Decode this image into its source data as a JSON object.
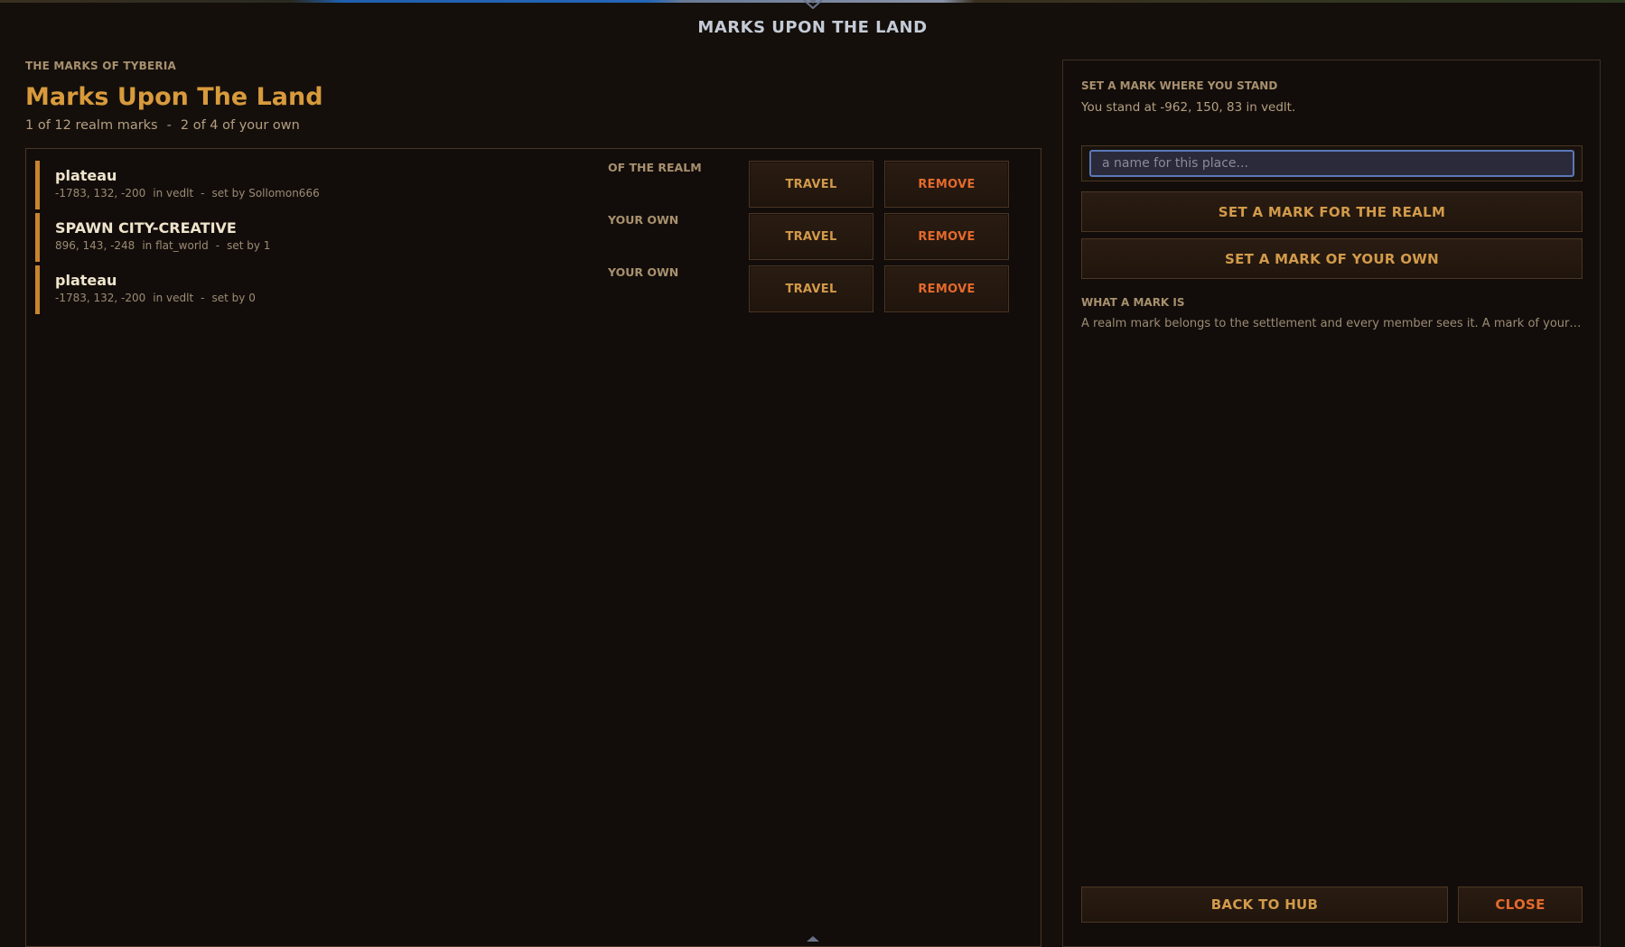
{
  "window": {
    "title": "MARKS UPON THE LAND"
  },
  "header": {
    "eyebrow": "THE MARKS OF TYBERIA",
    "title": "Marks Upon The Land",
    "realm_count": "1 of 12 realm marks",
    "separator": "-",
    "own_count": "2 of 4 of your own"
  },
  "marks": [
    {
      "name": "plateau",
      "coords": "-1783, 132, -200",
      "world": "in vedlt",
      "sep": "-",
      "setter": "set by Sollomon666",
      "kind": "OF THE REALM",
      "travel_label": "TRAVEL",
      "remove_label": "REMOVE"
    },
    {
      "name": "SPAWN CITY-CREATIVE",
      "coords": "896, 143, -248",
      "world": "in flat_world",
      "sep": "-",
      "setter": "set by 1",
      "kind": "YOUR OWN",
      "travel_label": "TRAVEL",
      "remove_label": "REMOVE"
    },
    {
      "name": "plateau",
      "coords": "-1783, 132, -200",
      "world": "in vedlt",
      "sep": "-",
      "setter": "set by 0",
      "kind": "YOUR OWN",
      "travel_label": "TRAVEL",
      "remove_label": "REMOVE"
    }
  ],
  "right": {
    "eyebrow": "SET A MARK WHERE YOU STAND",
    "location": "You stand at -962, 150, 83   in vedlt.",
    "name_placeholder": "a name for this place...",
    "set_realm_label": "SET A MARK FOR THE REALM",
    "set_own_label": "SET A MARK OF YOUR OWN",
    "info_title": "WHAT A MARK IS",
    "info_text": "A realm mark belongs to the settlement and every member sees it. A mark of your ow...",
    "back_label": "BACK TO HUB",
    "close_label": "CLOSE"
  },
  "colors": {
    "accent": "#d89a3c",
    "danger": "#e46a2c",
    "mark_bar": "#c8842e",
    "background": "#140f0b"
  }
}
